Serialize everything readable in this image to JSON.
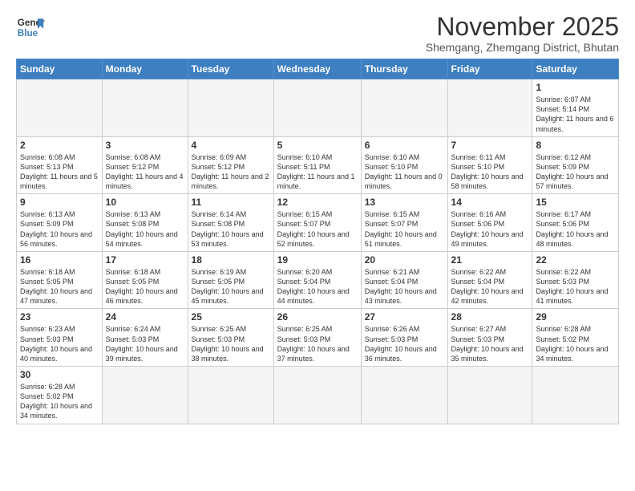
{
  "logo": {
    "line1": "General",
    "line2": "Blue"
  },
  "title": "November 2025",
  "subtitle": "Shemgang, Zhemgang District, Bhutan",
  "days_of_week": [
    "Sunday",
    "Monday",
    "Tuesday",
    "Wednesday",
    "Thursday",
    "Friday",
    "Saturday"
  ],
  "weeks": [
    [
      {
        "day": null
      },
      {
        "day": null
      },
      {
        "day": null
      },
      {
        "day": null
      },
      {
        "day": null
      },
      {
        "day": null
      },
      {
        "day": "1",
        "sunrise": "6:07 AM",
        "sunset": "5:14 PM",
        "daylight": "11 hours and 6 minutes."
      }
    ],
    [
      {
        "day": "2",
        "sunrise": "6:08 AM",
        "sunset": "5:13 PM",
        "daylight": "11 hours and 5 minutes."
      },
      {
        "day": "3",
        "sunrise": "6:08 AM",
        "sunset": "5:12 PM",
        "daylight": "11 hours and 4 minutes."
      },
      {
        "day": "4",
        "sunrise": "6:09 AM",
        "sunset": "5:12 PM",
        "daylight": "11 hours and 2 minutes."
      },
      {
        "day": "5",
        "sunrise": "6:10 AM",
        "sunset": "5:11 PM",
        "daylight": "11 hours and 1 minute."
      },
      {
        "day": "6",
        "sunrise": "6:10 AM",
        "sunset": "5:10 PM",
        "daylight": "11 hours and 0 minutes."
      },
      {
        "day": "7",
        "sunrise": "6:11 AM",
        "sunset": "5:10 PM",
        "daylight": "10 hours and 58 minutes."
      },
      {
        "day": "8",
        "sunrise": "6:12 AM",
        "sunset": "5:09 PM",
        "daylight": "10 hours and 57 minutes."
      }
    ],
    [
      {
        "day": "9",
        "sunrise": "6:13 AM",
        "sunset": "5:09 PM",
        "daylight": "10 hours and 56 minutes."
      },
      {
        "day": "10",
        "sunrise": "6:13 AM",
        "sunset": "5:08 PM",
        "daylight": "10 hours and 54 minutes."
      },
      {
        "day": "11",
        "sunrise": "6:14 AM",
        "sunset": "5:08 PM",
        "daylight": "10 hours and 53 minutes."
      },
      {
        "day": "12",
        "sunrise": "6:15 AM",
        "sunset": "5:07 PM",
        "daylight": "10 hours and 52 minutes."
      },
      {
        "day": "13",
        "sunrise": "6:15 AM",
        "sunset": "5:07 PM",
        "daylight": "10 hours and 51 minutes."
      },
      {
        "day": "14",
        "sunrise": "6:16 AM",
        "sunset": "5:06 PM",
        "daylight": "10 hours and 49 minutes."
      },
      {
        "day": "15",
        "sunrise": "6:17 AM",
        "sunset": "5:06 PM",
        "daylight": "10 hours and 48 minutes."
      }
    ],
    [
      {
        "day": "16",
        "sunrise": "6:18 AM",
        "sunset": "5:05 PM",
        "daylight": "10 hours and 47 minutes."
      },
      {
        "day": "17",
        "sunrise": "6:18 AM",
        "sunset": "5:05 PM",
        "daylight": "10 hours and 46 minutes."
      },
      {
        "day": "18",
        "sunrise": "6:19 AM",
        "sunset": "5:05 PM",
        "daylight": "10 hours and 45 minutes."
      },
      {
        "day": "19",
        "sunrise": "6:20 AM",
        "sunset": "5:04 PM",
        "daylight": "10 hours and 44 minutes."
      },
      {
        "day": "20",
        "sunrise": "6:21 AM",
        "sunset": "5:04 PM",
        "daylight": "10 hours and 43 minutes."
      },
      {
        "day": "21",
        "sunrise": "6:22 AM",
        "sunset": "5:04 PM",
        "daylight": "10 hours and 42 minutes."
      },
      {
        "day": "22",
        "sunrise": "6:22 AM",
        "sunset": "5:03 PM",
        "daylight": "10 hours and 41 minutes."
      }
    ],
    [
      {
        "day": "23",
        "sunrise": "6:23 AM",
        "sunset": "5:03 PM",
        "daylight": "10 hours and 40 minutes."
      },
      {
        "day": "24",
        "sunrise": "6:24 AM",
        "sunset": "5:03 PM",
        "daylight": "10 hours and 39 minutes."
      },
      {
        "day": "25",
        "sunrise": "6:25 AM",
        "sunset": "5:03 PM",
        "daylight": "10 hours and 38 minutes."
      },
      {
        "day": "26",
        "sunrise": "6:25 AM",
        "sunset": "5:03 PM",
        "daylight": "10 hours and 37 minutes."
      },
      {
        "day": "27",
        "sunrise": "6:26 AM",
        "sunset": "5:03 PM",
        "daylight": "10 hours and 36 minutes."
      },
      {
        "day": "28",
        "sunrise": "6:27 AM",
        "sunset": "5:03 PM",
        "daylight": "10 hours and 35 minutes."
      },
      {
        "day": "29",
        "sunrise": "6:28 AM",
        "sunset": "5:02 PM",
        "daylight": "10 hours and 34 minutes."
      }
    ],
    [
      {
        "day": "30",
        "sunrise": "6:28 AM",
        "sunset": "5:02 PM",
        "daylight": "10 hours and 34 minutes."
      },
      {
        "day": null
      },
      {
        "day": null
      },
      {
        "day": null
      },
      {
        "day": null
      },
      {
        "day": null
      },
      {
        "day": null
      }
    ]
  ]
}
